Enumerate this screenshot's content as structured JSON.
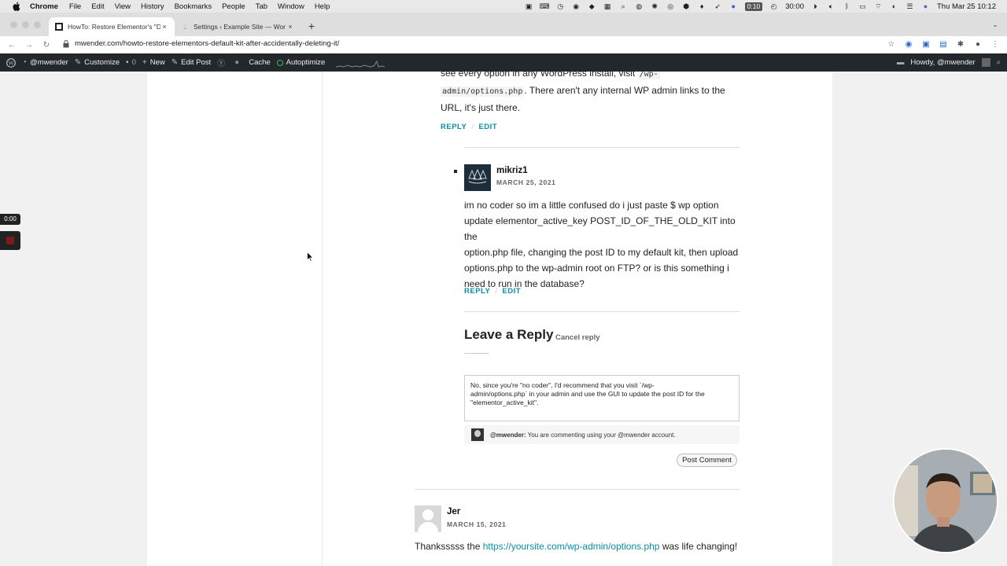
{
  "mac_menu": {
    "app": "Chrome",
    "items": [
      "File",
      "Edit",
      "View",
      "History",
      "Bookmarks",
      "People",
      "Tab",
      "Window",
      "Help"
    ],
    "recording_badge": "0:10",
    "timer": "30:00",
    "clock": "Thu Mar 25  10:12"
  },
  "tabs": [
    {
      "title": "HowTo: Restore Elementor's \"D",
      "active": true,
      "close": "×"
    },
    {
      "title": "Settings ‹ Example Site — Wor",
      "active": false,
      "close": "×"
    }
  ],
  "new_tab_label": "+",
  "address_bar": {
    "url": "mwender.com/howto-restore-elementors-default-kit-after-accidentally-deleting-it/"
  },
  "admin_bar": {
    "site": "@mwender",
    "customize": "Customize",
    "comments_count": "0",
    "new": "New",
    "edit_post": "Edit Post",
    "cache": "Cache",
    "autoptimize": "Autoptimize",
    "howdy": "Howdy, @mwender"
  },
  "prev_comment": {
    "line1_text": "see every option in any WordPress install, visit ",
    "line1_code": "/wp-",
    "line2_code": "admin/options.php",
    "line2_text": ". There aren't any internal WP admin links to the",
    "line3": "URL, it's just there.",
    "reply": "REPLY",
    "sep": "/",
    "edit": "EDIT"
  },
  "comment": {
    "author": "mikriz1",
    "date": "MARCH 25, 2021",
    "lines": [
      "im no coder so im a little confused do i just paste $ wp option",
      "update elementor_active_key POST_ID_OF_THE_OLD_KIT into the",
      "option.php file, changing the post ID to my default kit, then upload",
      "options.php to the wp-admin root on FTP? or is this something i",
      "need to run in the database?"
    ],
    "reply": "REPLY",
    "sep": "/",
    "edit": "EDIT"
  },
  "reply_form": {
    "title": "Leave a Reply",
    "cancel": "Cancel reply",
    "textarea_lines": [
      "No, since you're \"no coder\", I'd recommend that you visit `/wp-",
      "admin/options.php` in your admin and use the GUI to update the post ID for the",
      "\"elementor_active_kit\"."
    ],
    "logged_in_user": "@mwender:",
    "logged_in_text": " You are commenting using your @mwender account.",
    "submit": "Post Comment"
  },
  "next_comment": {
    "author": "Jer",
    "date": "MARCH 15, 2021",
    "text_before": "Thanksssss the ",
    "link": "https://yoursite.com/wp-admin/options.php",
    "text_after": " was life changing!"
  },
  "recorder": {
    "time": "0:00"
  },
  "colors": {
    "link": "#0a8ea5",
    "admin_bar": "#23282d",
    "autoptimize_dot": "#46b450"
  }
}
